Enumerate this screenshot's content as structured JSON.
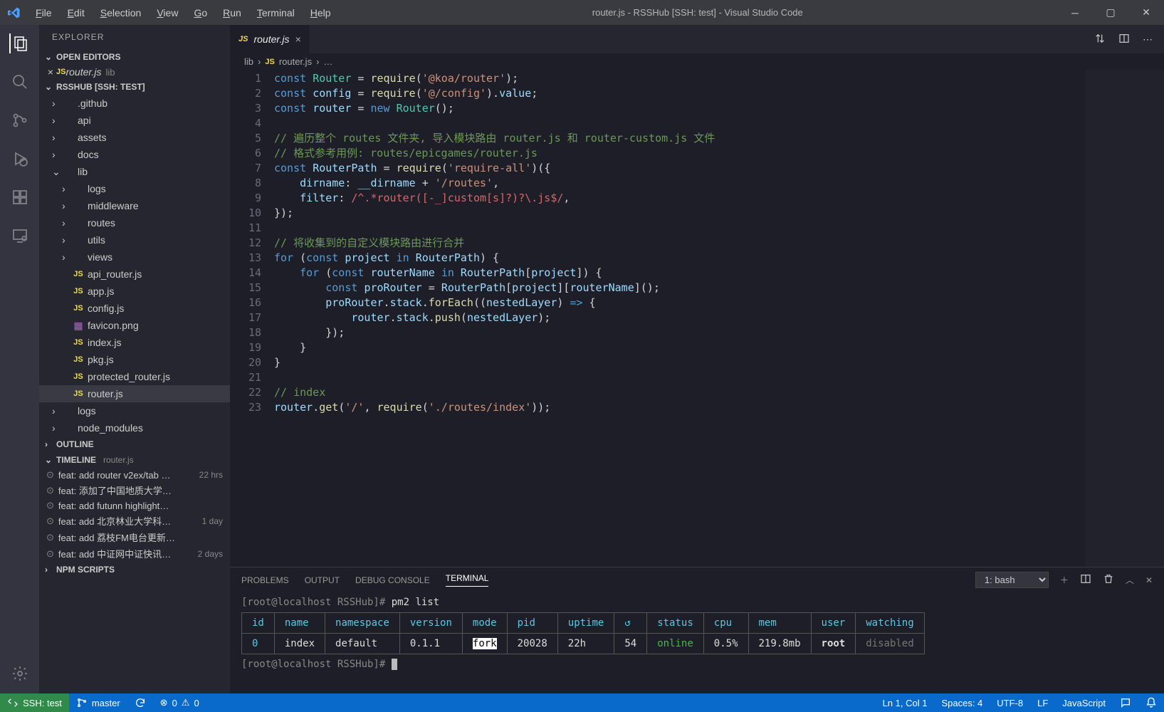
{
  "titlebar": {
    "menus": [
      "File",
      "Edit",
      "Selection",
      "View",
      "Go",
      "Run",
      "Terminal",
      "Help"
    ],
    "title": "router.js - RSSHub [SSH: test] - Visual Studio Code"
  },
  "activity": {
    "items": [
      "explorer",
      "search",
      "scm",
      "run-debug",
      "extensions",
      "remote"
    ]
  },
  "sidebar": {
    "title": "EXPLORER",
    "openEditors": {
      "label": "OPEN EDITORS",
      "items": [
        {
          "name": "router.js",
          "dir": "lib"
        }
      ]
    },
    "workspace": {
      "label": "RSSHUB [SSH: TEST]",
      "tree": [
        {
          "name": ".github",
          "type": "folder",
          "depth": 0
        },
        {
          "name": "api",
          "type": "folder",
          "depth": 0
        },
        {
          "name": "assets",
          "type": "folder",
          "depth": 0
        },
        {
          "name": "docs",
          "type": "folder",
          "depth": 0
        },
        {
          "name": "lib",
          "type": "folder",
          "depth": 0,
          "open": true
        },
        {
          "name": "logs",
          "type": "folder",
          "depth": 1
        },
        {
          "name": "middleware",
          "type": "folder",
          "depth": 1
        },
        {
          "name": "routes",
          "type": "folder",
          "depth": 1
        },
        {
          "name": "utils",
          "type": "folder",
          "depth": 1
        },
        {
          "name": "views",
          "type": "folder",
          "depth": 1
        },
        {
          "name": "api_router.js",
          "type": "js",
          "depth": 1
        },
        {
          "name": "app.js",
          "type": "js",
          "depth": 1
        },
        {
          "name": "config.js",
          "type": "js",
          "depth": 1
        },
        {
          "name": "favicon.png",
          "type": "img",
          "depth": 1
        },
        {
          "name": "index.js",
          "type": "js",
          "depth": 1
        },
        {
          "name": "pkg.js",
          "type": "js",
          "depth": 1
        },
        {
          "name": "protected_router.js",
          "type": "js",
          "depth": 1
        },
        {
          "name": "router.js",
          "type": "js",
          "depth": 1,
          "selected": true
        },
        {
          "name": "logs",
          "type": "folder",
          "depth": 0
        },
        {
          "name": "node_modules",
          "type": "folder",
          "depth": 0
        }
      ]
    },
    "outline": {
      "label": "OUTLINE"
    },
    "timeline": {
      "label": "TIMELINE",
      "file": "router.js",
      "items": [
        {
          "msg": "feat: add router v2ex/tab …",
          "time": "22 hrs"
        },
        {
          "msg": "feat: 添加了中国地质大学…",
          "time": ""
        },
        {
          "msg": "feat: add futunn highlight…",
          "time": ""
        },
        {
          "msg": "feat: add 北京林业大学科…",
          "time": "1 day"
        },
        {
          "msg": "feat: add 荔枝FM电台更新…",
          "time": ""
        },
        {
          "msg": "feat: add 中证网中证快讯…",
          "time": "2 days"
        }
      ]
    },
    "npm": {
      "label": "NPM SCRIPTS"
    }
  },
  "editor": {
    "tab": {
      "name": "router.js"
    },
    "breadcrumb": [
      "lib",
      "router.js",
      "…"
    ],
    "lines": 23
  },
  "panel": {
    "tabs": [
      "PROBLEMS",
      "OUTPUT",
      "DEBUG CONSOLE",
      "TERMINAL"
    ],
    "active": "TERMINAL",
    "terminalSelector": "1: bash",
    "prompt1": "[root@localhost RSSHub]# pm2 list",
    "prompt2": "[root@localhost RSSHub]# ",
    "table": {
      "headers": [
        "id",
        "name",
        "namespace",
        "version",
        "mode",
        "pid",
        "uptime",
        "↺",
        "status",
        "cpu",
        "mem",
        "user",
        "watching"
      ],
      "row": {
        "id": "0",
        "name": "index",
        "namespace": "default",
        "version": "0.1.1",
        "mode": "fork",
        "pid": "20028",
        "uptime": "22h",
        "restarts": "54",
        "status": "online",
        "cpu": "0.5%",
        "mem": "219.8mb",
        "user": "root",
        "watching": "disabled"
      }
    }
  },
  "status": {
    "ssh": "SSH: test",
    "branch": "master",
    "sync": "",
    "errors": "0",
    "warnings": "0",
    "ln": "Ln 1, Col 1",
    "spaces": "Spaces: 4",
    "encoding": "UTF-8",
    "eol": "LF",
    "lang": "JavaScript"
  }
}
